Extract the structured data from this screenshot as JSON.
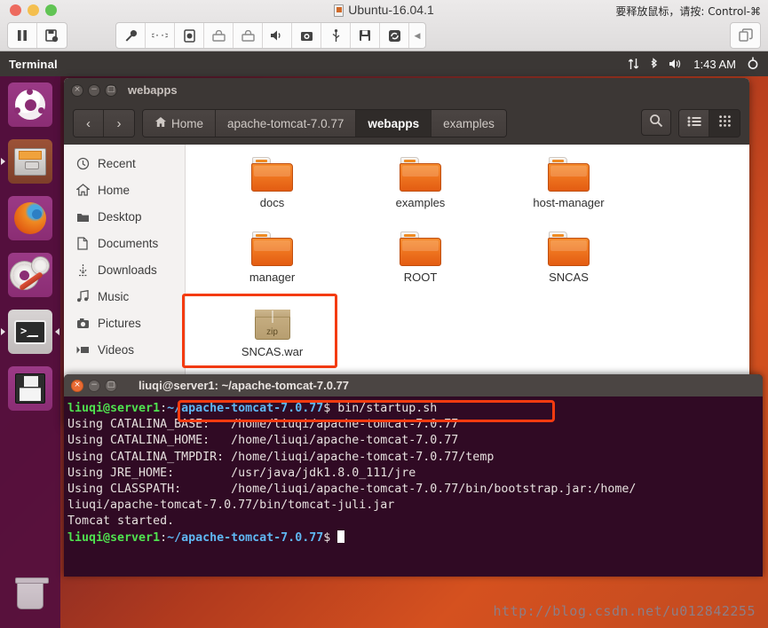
{
  "vm": {
    "title": "Ubuntu-16.04.1",
    "release_hint": "要释放鼠标，请按: Control-⌘",
    "toolbar_left": [
      {
        "name": "pause-button",
        "icon": "pause-icon"
      },
      {
        "name": "snapshot-button",
        "icon": "snapshot-icon"
      }
    ],
    "toolbar_mid": [
      {
        "name": "settings-button",
        "icon": "wrench-icon"
      },
      {
        "name": "network-button",
        "icon": "network-icon"
      },
      {
        "name": "harddisk-button",
        "icon": "harddisk-icon"
      },
      {
        "name": "cd-drive-1-button",
        "icon": "optical-disc-icon"
      },
      {
        "name": "cd-drive-2-button",
        "icon": "optical-disc-icon"
      },
      {
        "name": "sound-button",
        "icon": "speaker-icon"
      },
      {
        "name": "camera-button",
        "icon": "camera-icon"
      },
      {
        "name": "usb-button",
        "icon": "usb-icon"
      },
      {
        "name": "floppy-button",
        "icon": "floppy-icon"
      },
      {
        "name": "sync-button",
        "icon": "sync-icon"
      }
    ],
    "toolbar_collapse": "◀",
    "toolbar_right": {
      "name": "fullscreen-button",
      "icon": "windows-icon"
    }
  },
  "panel": {
    "app_name": "Terminal",
    "clock": "1:43 AM",
    "indicators": [
      {
        "name": "network-indicator",
        "icon": "up-down-arrows-icon"
      },
      {
        "name": "bluetooth-indicator",
        "icon": "bluetooth-icon"
      },
      {
        "name": "volume-indicator",
        "icon": "speaker-icon"
      }
    ],
    "session_menu": {
      "name": "gear-icon"
    }
  },
  "launcher": {
    "items": [
      {
        "name": "launcher-item-dash",
        "icon": "ubuntu-logo-icon",
        "active": false
      },
      {
        "name": "launcher-item-files",
        "icon": "file-cabinet-icon",
        "active": true,
        "running": true
      },
      {
        "name": "launcher-item-firefox",
        "icon": "firefox-icon",
        "active": false
      },
      {
        "name": "launcher-item-system-settings",
        "icon": "gear-wrench-icon",
        "active": false
      },
      {
        "name": "launcher-item-terminal",
        "icon": "terminal-icon",
        "active": true,
        "running": true
      },
      {
        "name": "launcher-item-save",
        "icon": "floppy-disk-icon",
        "active": false
      }
    ],
    "trash": {
      "name": "launcher-item-trash",
      "icon": "trash-icon"
    }
  },
  "files_window": {
    "title": "webapps",
    "window_buttons": {
      "close": "×",
      "minimize": "−",
      "maximize": "□"
    },
    "nav": {
      "back": "‹",
      "forward": "›"
    },
    "breadcrumbs": [
      {
        "label": "Home",
        "icon": "home-icon",
        "current": false
      },
      {
        "label": "apache-tomcat-7.0.77",
        "icon": "",
        "current": false
      },
      {
        "label": "webapps",
        "icon": "",
        "current": true
      },
      {
        "label": "examples",
        "icon": "",
        "current": false
      }
    ],
    "actions": [
      {
        "name": "search-button",
        "icon": "search-icon"
      },
      {
        "name": "list-view-button",
        "icon": "list-view-icon",
        "selected": false
      },
      {
        "name": "grid-view-button",
        "icon": "grid-view-icon",
        "selected": true
      }
    ],
    "sidebar": [
      {
        "label": "Recent",
        "icon": "clock-icon"
      },
      {
        "label": "Home",
        "icon": "home-icon"
      },
      {
        "label": "Desktop",
        "icon": "folder-icon"
      },
      {
        "label": "Documents",
        "icon": "document-icon"
      },
      {
        "label": "Downloads",
        "icon": "download-icon"
      },
      {
        "label": "Music",
        "icon": "music-note-icon"
      },
      {
        "label": "Pictures",
        "icon": "camera-icon"
      },
      {
        "label": "Videos",
        "icon": "video-icon"
      }
    ],
    "files": [
      {
        "label": "docs",
        "type": "folder",
        "highlighted": false
      },
      {
        "label": "examples",
        "type": "folder",
        "highlighted": false
      },
      {
        "label": "host-manager",
        "type": "folder",
        "highlighted": false
      },
      {
        "label": "manager",
        "type": "folder",
        "highlighted": false
      },
      {
        "label": "ROOT",
        "type": "folder",
        "highlighted": false
      },
      {
        "label": "SNCAS",
        "type": "folder",
        "highlighted": false
      },
      {
        "label": "SNCAS.war",
        "type": "zip",
        "zip_badge": "zip",
        "highlighted": true
      }
    ]
  },
  "terminal": {
    "title": "liuqi@server1: ~/apache-tomcat-7.0.77",
    "window_buttons": {
      "close": "×",
      "minimize": "−",
      "maximize": "□"
    },
    "prompt_user": "liuqi@server1",
    "prompt_path": "~/apache-tomcat-7.0.77",
    "command": "bin/startup.sh",
    "lines": [
      "Using CATALINA_BASE:   /home/liuqi/apache-tomcat-7.0.77",
      "Using CATALINA_HOME:   /home/liuqi/apache-tomcat-7.0.77",
      "Using CATALINA_TMPDIR: /home/liuqi/apache-tomcat-7.0.77/temp",
      "Using JRE_HOME:        /usr/java/jdk1.8.0_111/jre",
      "Using CLASSPATH:       /home/liuqi/apache-tomcat-7.0.77/bin/bootstrap.jar:/home/",
      "liuqi/apache-tomcat-7.0.77/bin/tomcat-juli.jar",
      "Tomcat started."
    ]
  },
  "watermark": "http://blog.csdn.net/u012842255",
  "colors": {
    "terminal_bg": "#300a24",
    "prompt_green": "#4fe24f",
    "prompt_blue": "#5fb7f2",
    "highlight_red": "#f43b10",
    "ubuntu_orange": "#ef7620",
    "panel_dark": "#3b3735",
    "launcher_purple": "#540f3e"
  }
}
